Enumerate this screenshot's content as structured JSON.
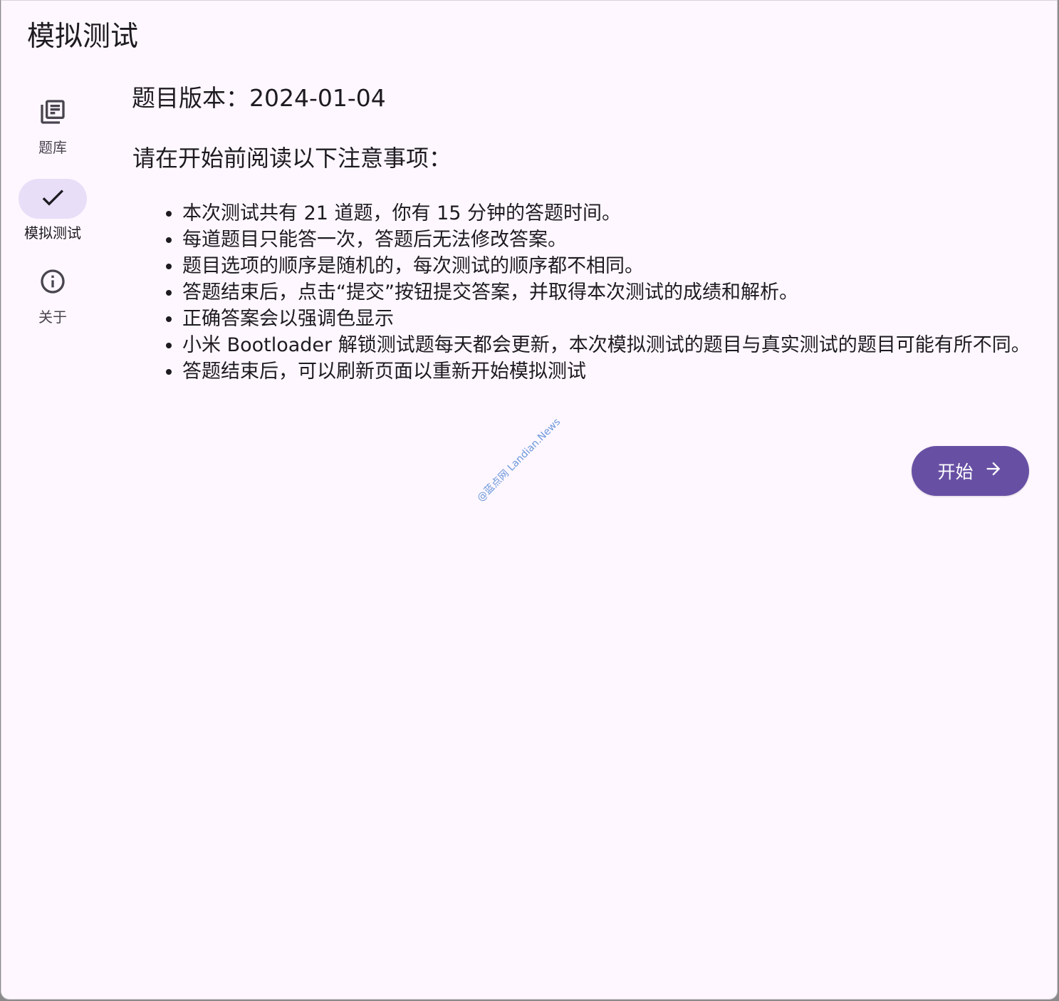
{
  "app": {
    "title": "模拟测试"
  },
  "nav": {
    "items": [
      {
        "label": "题库",
        "icon": "library-books-icon",
        "active": false
      },
      {
        "label": "模拟测试",
        "icon": "check-icon",
        "active": true
      },
      {
        "label": "关于",
        "icon": "info-icon",
        "active": false
      }
    ]
  },
  "main": {
    "version": "题目版本：2024-01-04",
    "notice_heading": "请在开始前阅读以下注意事项：",
    "notices": [
      "本次测试共有 21 道题，你有 15 分钟的答题时间。",
      "每道题目只能答一次，答题后无法修改答案。",
      "题目选项的顺序是随机的，每次测试的顺序都不相同。",
      "答题结束后，点击“提交”按钮提交答案，并取得本次测试的成绩和解析。",
      "正确答案会以强调色显示",
      "小米 Bootloader 解锁测试题每天都会更新，本次模拟测试的题目与真实测试的题目可能有所不同。",
      "答题结束后，可以刷新页面以重新开始模拟测试"
    ],
    "start_label": "开始"
  },
  "watermark": "@蓝点网 Landian.News",
  "colors": {
    "background": "#fef7ff",
    "primary": "#6750a4",
    "active_indicator": "#e8def8",
    "text": "#1d1b20"
  }
}
